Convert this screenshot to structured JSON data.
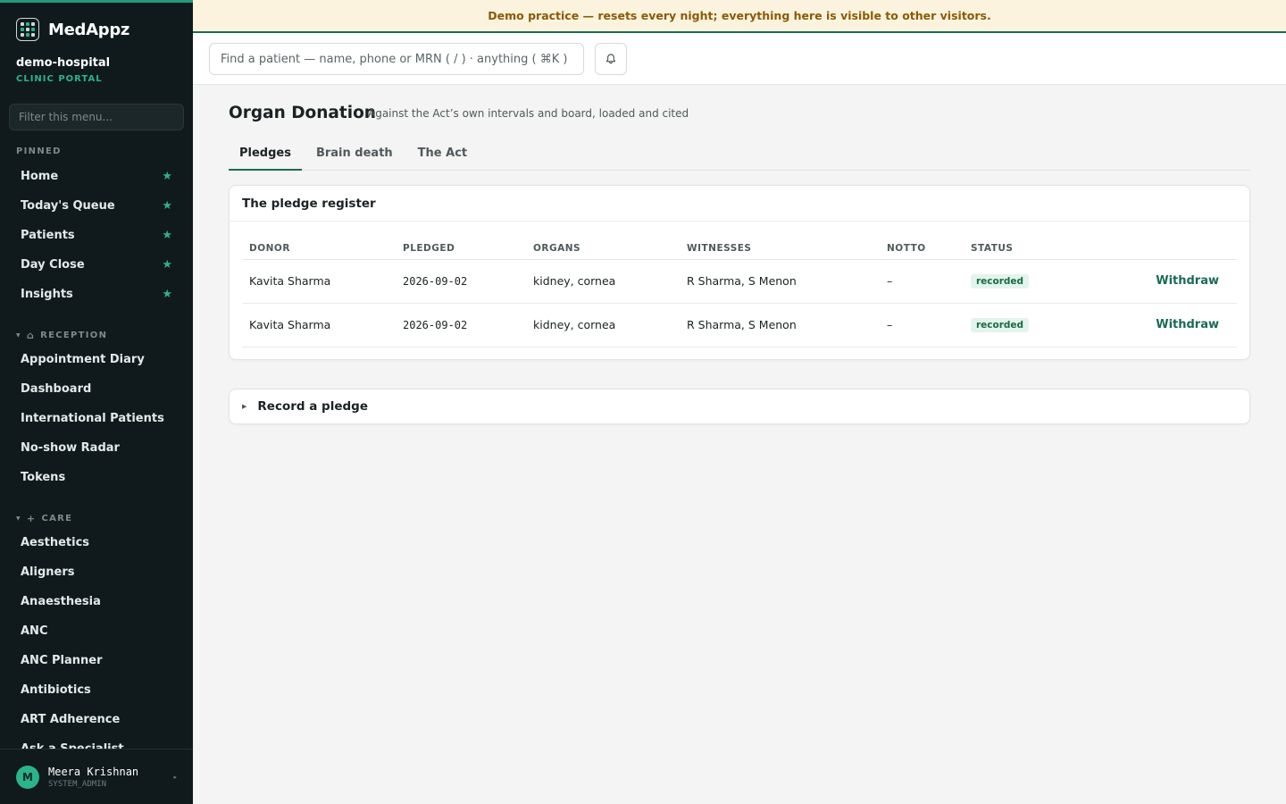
{
  "brand": {
    "name": "MedAppz"
  },
  "org": {
    "name": "demo-hospital",
    "subtitle": "CLINIC PORTAL"
  },
  "sidebar": {
    "filter_placeholder": "Filter this menu...",
    "pinned_label": "PINNED",
    "pinned": [
      {
        "label": "Home"
      },
      {
        "label": "Today's Queue"
      },
      {
        "label": "Patients"
      },
      {
        "label": "Day Close"
      },
      {
        "label": "Insights"
      }
    ],
    "reception_label": "RECEPTION",
    "reception": [
      {
        "label": "Appointment Diary"
      },
      {
        "label": "Dashboard"
      },
      {
        "label": "International Patients"
      },
      {
        "label": "No-show Radar"
      },
      {
        "label": "Tokens"
      }
    ],
    "care_label": "CARE",
    "care": [
      {
        "label": "Aesthetics"
      },
      {
        "label": "Aligners"
      },
      {
        "label": "Anaesthesia"
      },
      {
        "label": "ANC"
      },
      {
        "label": "ANC Planner"
      },
      {
        "label": "Antibiotics"
      },
      {
        "label": "ART Adherence"
      },
      {
        "label": "Ask a Specialist"
      }
    ],
    "star_glyph": "★",
    "user": {
      "initial": "M",
      "name": "Meera Krishnan",
      "role": "SYSTEM_ADMIN"
    }
  },
  "banner": {
    "text": "Demo practice — resets every night; everything here is visible to other visitors."
  },
  "topbar": {
    "search_placeholder": "Find a patient — name, phone or MRN ( / ) · anything ( ⌘K )"
  },
  "page": {
    "title": "Organ Donation",
    "subtitle": "Against the Act’s own intervals and board, loaded and cited",
    "tabs": [
      {
        "label": "Pledges"
      },
      {
        "label": "Brain death"
      },
      {
        "label": "The Act"
      }
    ]
  },
  "register": {
    "title": "The pledge register",
    "columns": [
      "DONOR",
      "PLEDGED",
      "ORGANS",
      "WITNESSES",
      "NOTTO",
      "STATUS"
    ],
    "rows": [
      {
        "donor": "Kavita Sharma",
        "pledged": "2026-09-02",
        "organs": "kidney, cornea",
        "witnesses": "R Sharma, S Menon",
        "notto": "–",
        "status": "recorded",
        "action": "Withdraw"
      },
      {
        "donor": "Kavita Sharma",
        "pledged": "2026-09-02",
        "organs": "kidney, cornea",
        "witnesses": "R Sharma, S Menon",
        "notto": "–",
        "status": "recorded",
        "action": "Withdraw"
      }
    ]
  },
  "record": {
    "label": "Record a pledge"
  },
  "colors": {
    "accent": "#1a6a55",
    "brand_green": "#2bb38a",
    "sidebar_bg": "#101a1c",
    "banner_bg": "#fbf3dd",
    "banner_text": "#8a5a06"
  },
  "icons": {
    "bell": "bell-icon",
    "reception": "home-icon",
    "care": "plus-icon"
  }
}
